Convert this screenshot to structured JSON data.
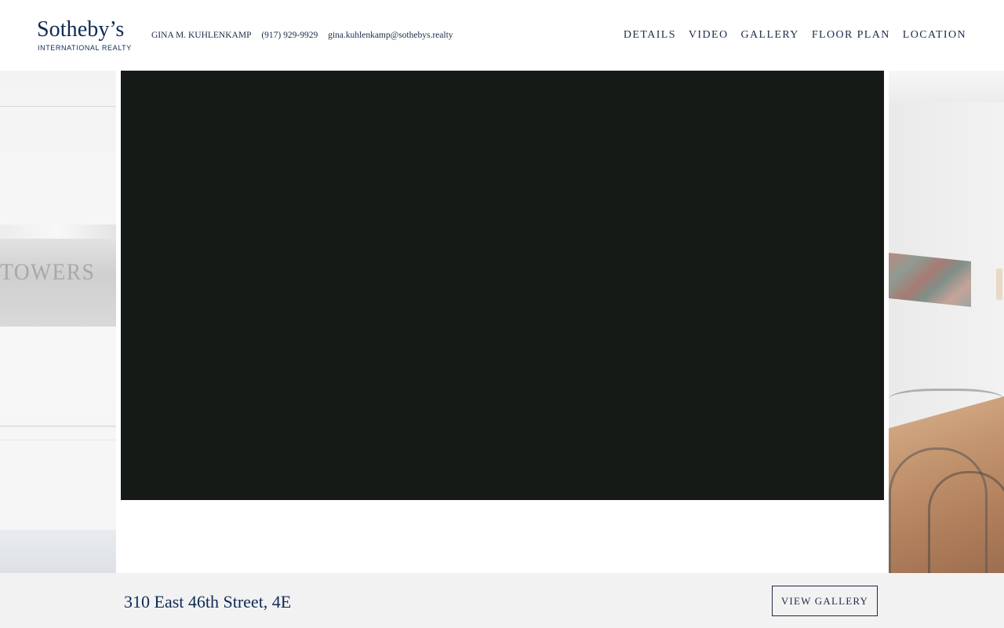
{
  "brand": {
    "logo_main": "Sotheby’s",
    "logo_sub": "INTERNATIONAL REALTY",
    "color": "#0f2a55"
  },
  "agent": {
    "name": "GINA M. KUHLENKAMP",
    "phone": "(917) 929-9929",
    "email": "gina.kuhlenkamp@sothebys.realty"
  },
  "nav": {
    "items": [
      {
        "label": "DETAILS"
      },
      {
        "label": "VIDEO"
      },
      {
        "label": "GALLERY"
      },
      {
        "label": "FLOOR PLAN"
      },
      {
        "label": "LOCATION"
      }
    ]
  },
  "hero": {
    "left_image_sign_text": "TOWERS",
    "video_background": "#151a17"
  },
  "footer": {
    "address": "310 East 46th Street, 4E",
    "gallery_button": "VIEW GALLERY",
    "background": "#f2f2f2"
  }
}
